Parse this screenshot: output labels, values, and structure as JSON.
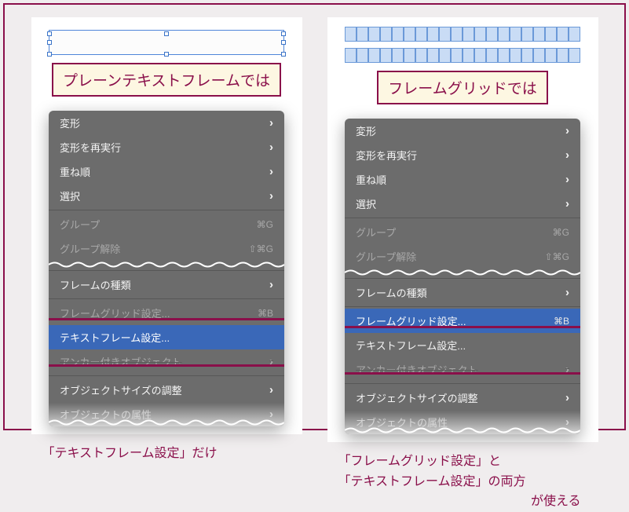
{
  "left": {
    "title": "プレーンテキストフレームでは",
    "caption": "「テキストフレーム設定」だけ"
  },
  "right": {
    "title": "フレームグリッドでは",
    "caption_line1": "「フレームグリッド設定」と",
    "caption_line2": "「テキストフレーム設定」の両方",
    "caption_line3": "が使える"
  },
  "menu": {
    "transform": "変形",
    "repeat_transform": "変形を再実行",
    "arrange": "重ね順",
    "select": "選択",
    "group": "グループ",
    "group_sc": "⌘G",
    "ungroup": "グループ解除",
    "ungroup_sc": "⇧⌘G",
    "frame_type": "フレームの種類",
    "frame_grid_settings": "フレームグリッド設定...",
    "frame_grid_sc": "⌘B",
    "text_frame_settings": "テキストフレーム設定...",
    "anchor_object": "アンカー付きオブジェクト",
    "object_size_adjust": "オブジェクトサイズの調整",
    "object_attributes": "オブジェクトの属性"
  }
}
